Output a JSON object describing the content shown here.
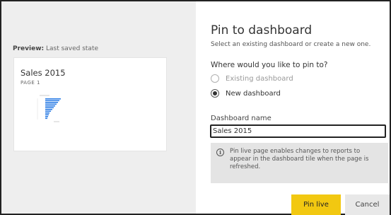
{
  "preview": {
    "caption_bold": "Preview:",
    "caption_rest": " Last saved state",
    "card_title": "Sales 2015",
    "card_page": "PAGE 1",
    "chart_color": "#2f7fe6"
  },
  "dialog": {
    "title": "Pin to dashboard",
    "subtitle": "Select an existing dashboard or create a new one.",
    "question": "Where would you like to pin to?",
    "options": [
      {
        "label": "Existing dashboard",
        "selected": false,
        "enabled": false
      },
      {
        "label": "New dashboard",
        "selected": true,
        "enabled": true
      }
    ],
    "name_label": "Dashboard name",
    "name_value": "Sales 2015",
    "info_icon": "info-icon",
    "info_text": "Pin live page enables changes to reports to appear in the dashboard tile when the page is refreshed.",
    "pin_label": "Pin live",
    "cancel_label": "Cancel",
    "accent": "#f2c811"
  }
}
